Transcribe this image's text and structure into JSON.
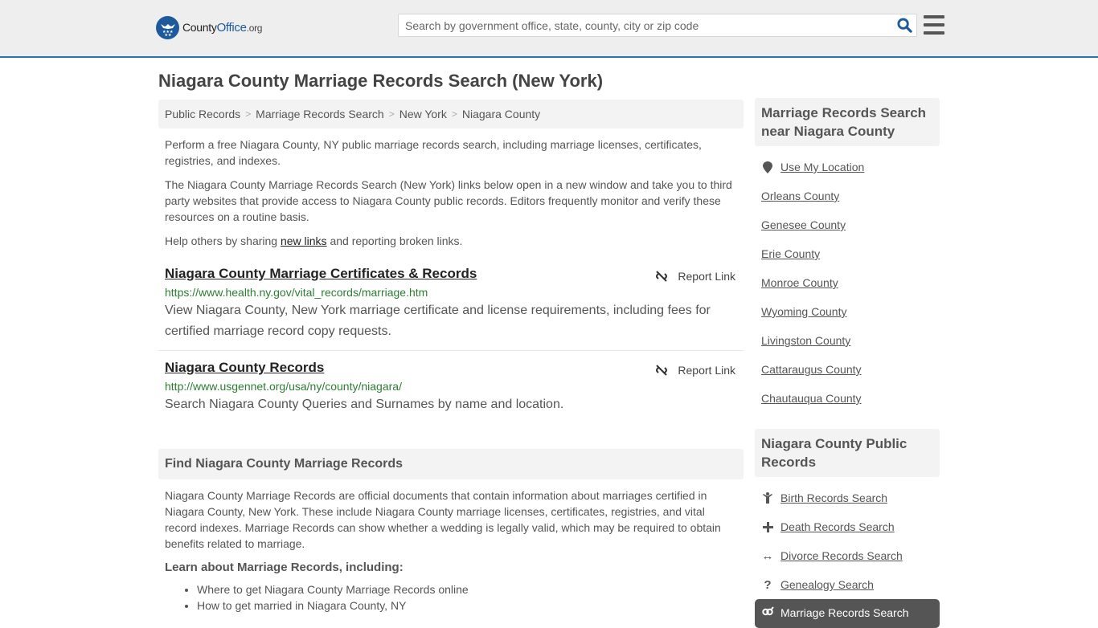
{
  "header": {
    "logo": {
      "name": "County",
      "office": "Office",
      "tld": ".org"
    },
    "search": {
      "placeholder": "Search by government office, state, county, city or zip code",
      "value": ""
    }
  },
  "page_title": "Niagara County Marriage Records Search (New York)",
  "breadcrumb": [
    {
      "label": "Public Records"
    },
    {
      "label": "Marriage Records Search"
    },
    {
      "label": "New York"
    },
    {
      "label": "Niagara County"
    }
  ],
  "intro": {
    "p1": "Perform a free Niagara County, NY public marriage records search, including marriage licenses, certificates, registries, and indexes.",
    "p2": "The Niagara County Marriage Records Search (New York) links below open in a new window and take you to third party websites that provide access to Niagara County public records. Editors frequently monitor and verify these resources on a routine basis.",
    "p3_before": "Help others by sharing ",
    "p3_link": "new links",
    "p3_after": " and reporting broken links."
  },
  "results": [
    {
      "title": "Niagara County Marriage Certificates & Records",
      "url": "https://www.health.ny.gov/vital_records/marriage.htm",
      "description": "View Niagara County, New York marriage certificate and license requirements, including fees for certified marriage record copy requests.",
      "report_label": "Report Link"
    },
    {
      "title": "Niagara County Records",
      "url": "http://www.usgennet.org/usa/ny/county/niagara/",
      "description": "Search Niagara County Queries and Surnames by name and location.",
      "report_label": "Report Link"
    }
  ],
  "find_section": {
    "heading": "Find Niagara County Marriage Records",
    "body": "Niagara County Marriage Records are official documents that contain information about marriages certified in Niagara County, New York. These include Niagara County marriage licenses, certificates, registries, and vital record indexes. Marriage Records can show whether a wedding is legally valid, which may be required to obtain benefits related to marriage.",
    "learn_heading": "Learn about Marriage Records, including:",
    "learn_items": [
      "Where to get Niagara County Marriage Records online",
      "How to get married in Niagara County, NY"
    ]
  },
  "sidebar": {
    "near": {
      "heading": "Marriage Records Search near Niagara County",
      "use_location": "Use My Location",
      "counties": [
        "Orleans County",
        "Genesee County",
        "Erie County",
        "Monroe County",
        "Wyoming County",
        "Livingston County",
        "Cattaraugus County",
        "Chautauqua County"
      ]
    },
    "public": {
      "heading": "Niagara County Public Records",
      "items": [
        {
          "label": "Birth Records Search",
          "icon": "child-icon"
        },
        {
          "label": "Death Records Search",
          "icon": "cross-icon"
        },
        {
          "label": "Divorce Records Search",
          "icon": "arrows-horizontal-icon"
        },
        {
          "label": "Genealogy Search",
          "icon": "question-icon"
        },
        {
          "label": "Marriage Records Search",
          "icon": "gender-rings-icon",
          "active": true
        }
      ]
    }
  },
  "colors": {
    "brand_blue": "#1c5a9c",
    "header_border": "#2f73ad",
    "url_green": "#2e7d32",
    "active_bg": "#555555"
  }
}
